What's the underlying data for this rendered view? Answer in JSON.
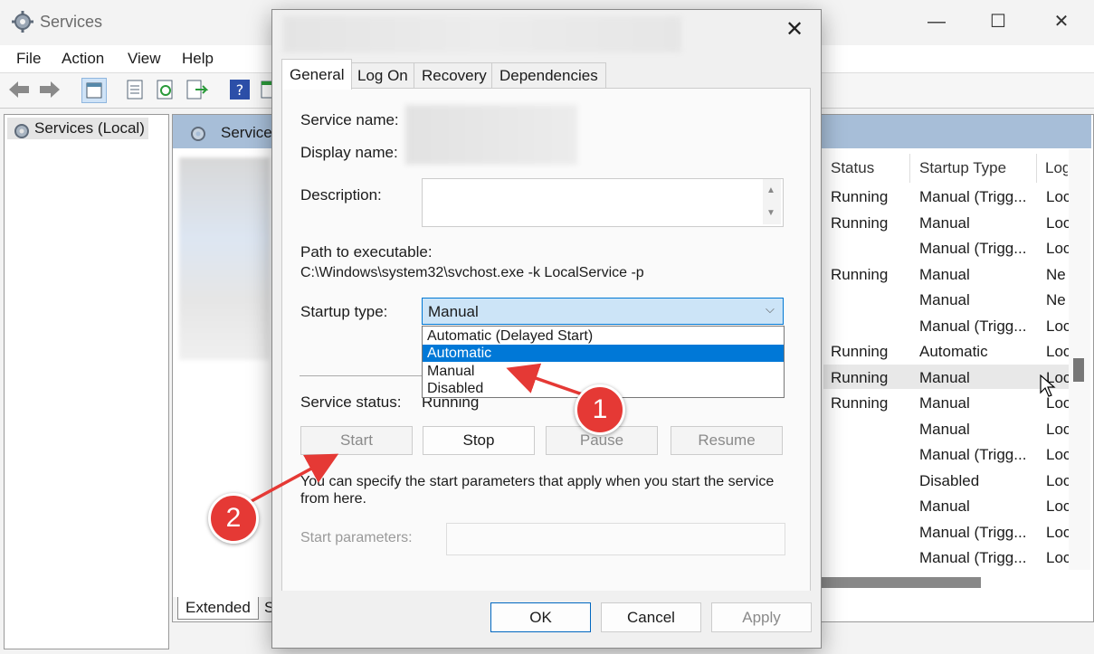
{
  "window": {
    "title": "Services",
    "minimize": "—",
    "maximize": "☐",
    "close": "✕"
  },
  "menu": [
    "File",
    "Action",
    "View",
    "Help"
  ],
  "tree": {
    "item": "Services (Local)"
  },
  "center": {
    "header": "Service",
    "tab": "Extended",
    "tab2": "S"
  },
  "table": {
    "headers": [
      "Status",
      "Startup Type",
      "Log"
    ],
    "rows": [
      [
        "Running",
        "Manual (Trigg...",
        "Loc"
      ],
      [
        "Running",
        "Manual",
        "Loc"
      ],
      [
        "",
        "Manual (Trigg...",
        "Loc"
      ],
      [
        "Running",
        "Manual",
        "Ne"
      ],
      [
        "",
        "Manual",
        "Ne"
      ],
      [
        "",
        "Manual (Trigg...",
        "Loc"
      ],
      [
        "Running",
        "Automatic",
        "Loc"
      ],
      [
        "Running",
        "Manual",
        "Loc"
      ],
      [
        "Running",
        "Manual",
        "Loc"
      ],
      [
        "",
        "Manual",
        "Loc"
      ],
      [
        "",
        "Manual (Trigg...",
        "Loc"
      ],
      [
        "",
        "Disabled",
        "Loc"
      ],
      [
        "",
        "Manual",
        "Loc"
      ],
      [
        "",
        "Manual (Trigg...",
        "Loc"
      ],
      [
        "",
        "Manual (Trigg...",
        "Loc"
      ]
    ],
    "selected_row": 7
  },
  "dialog": {
    "close": "✕",
    "tabs": [
      "General",
      "Log On",
      "Recovery",
      "Dependencies"
    ],
    "active_tab": "General",
    "service_name_label": "Service name:",
    "display_name_label": "Display name:",
    "description_label": "Description:",
    "path_label": "Path to executable:",
    "path_value": "C:\\Windows\\system32\\svchost.exe -k LocalService -p",
    "startup_type_label": "Startup type:",
    "startup_type_value": "Manual",
    "startup_options": [
      "Automatic (Delayed Start)",
      "Automatic",
      "Manual",
      "Disabled"
    ],
    "highlighted_option": "Automatic",
    "service_status_label": "Service status:",
    "service_status_value": "Running",
    "buttons": {
      "start": "Start",
      "stop": "Stop",
      "pause": "Pause",
      "resume": "Resume"
    },
    "hint": "You can specify the start parameters that apply when you start the service from here.",
    "start_params_label": "Start parameters:",
    "footer": {
      "ok": "OK",
      "cancel": "Cancel",
      "apply": "Apply"
    }
  },
  "annotations": {
    "badge1": "1",
    "badge2": "2",
    "color": "#e53935"
  }
}
